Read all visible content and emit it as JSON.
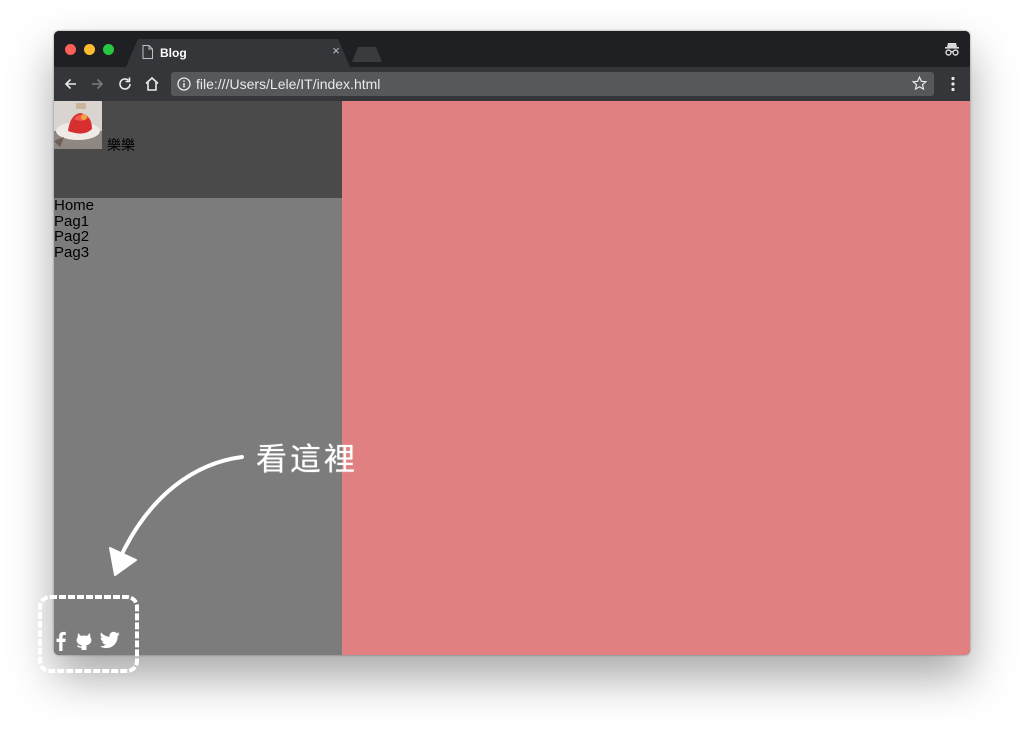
{
  "browser": {
    "tab_title": "Blog",
    "tab_close": "×",
    "url": "file:///Users/Lele/IT/index.html"
  },
  "page": {
    "profile_name": "樂樂",
    "nav": [
      {
        "label": "Home"
      },
      {
        "label": "Pag1"
      },
      {
        "label": "Pag2"
      },
      {
        "label": "Pag3"
      }
    ],
    "social_icons": [
      "facebook-icon",
      "github-icon",
      "twitter-icon"
    ]
  },
  "annotation": {
    "text": "看這裡"
  },
  "colors": {
    "sidebar_header": "#4a4a4a",
    "sidebar": "#7c7c7c",
    "main": "#e08080",
    "chrome_dark": "#202124",
    "chrome_toolbar": "#35363a"
  }
}
